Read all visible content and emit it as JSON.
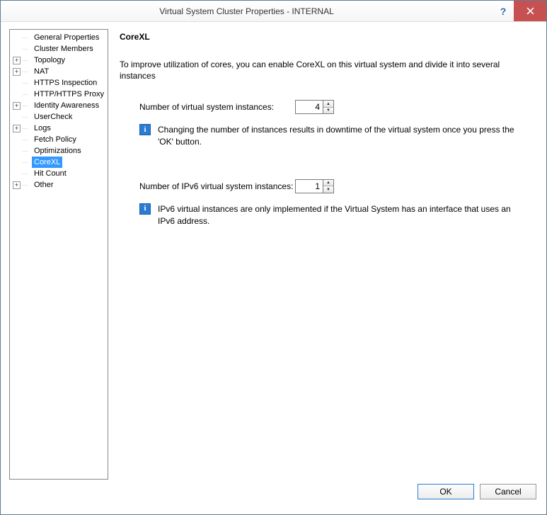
{
  "window": {
    "title": "Virtual System Cluster Properties - INTERNAL"
  },
  "sidebar": {
    "items": [
      {
        "label": "General Properties",
        "expandable": false
      },
      {
        "label": "Cluster Members",
        "expandable": false
      },
      {
        "label": "Topology",
        "expandable": true
      },
      {
        "label": "NAT",
        "expandable": true
      },
      {
        "label": "HTTPS Inspection",
        "expandable": false
      },
      {
        "label": "HTTP/HTTPS Proxy",
        "expandable": false
      },
      {
        "label": "Identity Awareness",
        "expandable": true
      },
      {
        "label": "UserCheck",
        "expandable": false
      },
      {
        "label": "Logs",
        "expandable": true
      },
      {
        "label": "Fetch Policy",
        "expandable": false
      },
      {
        "label": "Optimizations",
        "expandable": false
      },
      {
        "label": "CoreXL",
        "expandable": false,
        "selected": true
      },
      {
        "label": "Hit Count",
        "expandable": false
      },
      {
        "label": "Other",
        "expandable": true
      }
    ]
  },
  "content": {
    "title": "CoreXL",
    "intro": "To improve utilization of cores, you can enable CoreXL on this virtual system and divide it into several instances",
    "instances_label": "Number of virtual system instances:",
    "instances_value": "4",
    "instances_info": "Changing the number of instances results in downtime of the virtual system once you press the 'OK' button.",
    "ipv6_label": "Number of IPv6 virtual system instances:",
    "ipv6_value": "1",
    "ipv6_info": "IPv6 virtual instances are only implemented if the Virtual System has an interface that uses an IPv6 address."
  },
  "buttons": {
    "ok": "OK",
    "cancel": "Cancel"
  }
}
